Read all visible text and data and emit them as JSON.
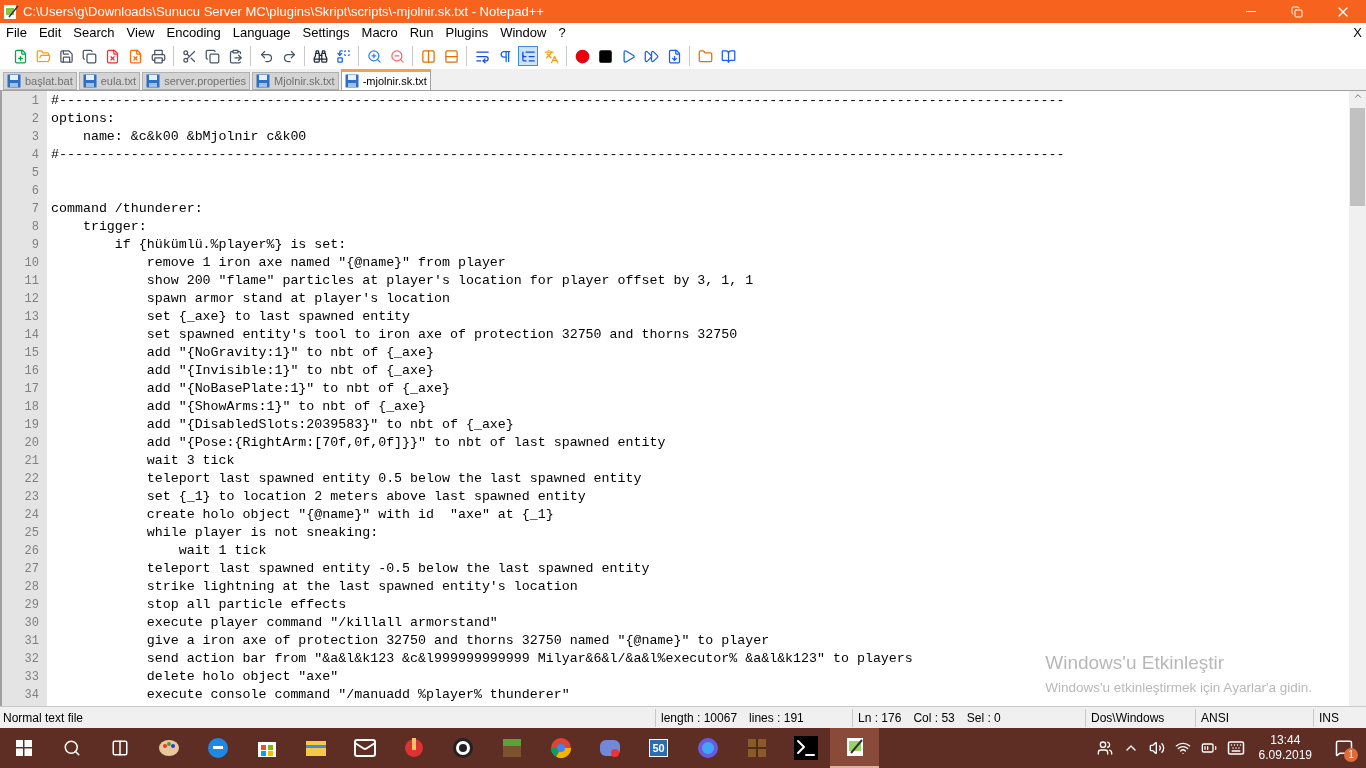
{
  "window": {
    "title": "C:\\Users\\g\\Downloads\\Sunucu Server MC\\plugins\\Skript\\scripts\\-mjolnir.sk.txt - Notepad++"
  },
  "menu": [
    "File",
    "Edit",
    "Search",
    "View",
    "Encoding",
    "Language",
    "Settings",
    "Macro",
    "Run",
    "Plugins",
    "Window",
    "?"
  ],
  "menu_close": "X",
  "toolbar": [
    {
      "kind": "new",
      "pressed": false
    },
    {
      "kind": "open",
      "pressed": false
    },
    {
      "kind": "save",
      "pressed": false
    },
    {
      "kind": "save-all",
      "pressed": false
    },
    {
      "kind": "close",
      "pressed": false
    },
    {
      "kind": "close-all",
      "pressed": false
    },
    {
      "kind": "print",
      "pressed": false
    },
    {
      "kind": "sep"
    },
    {
      "kind": "cut",
      "pressed": false
    },
    {
      "kind": "copy",
      "pressed": false
    },
    {
      "kind": "paste",
      "pressed": false
    },
    {
      "kind": "sep"
    },
    {
      "kind": "undo",
      "pressed": false
    },
    {
      "kind": "redo",
      "pressed": false
    },
    {
      "kind": "sep"
    },
    {
      "kind": "find",
      "pressed": false
    },
    {
      "kind": "replace",
      "pressed": false
    },
    {
      "kind": "sep"
    },
    {
      "kind": "zoom-in",
      "pressed": false
    },
    {
      "kind": "zoom-out",
      "pressed": false
    },
    {
      "kind": "sep"
    },
    {
      "kind": "sync-v",
      "pressed": false
    },
    {
      "kind": "sync-h",
      "pressed": false
    },
    {
      "kind": "sep"
    },
    {
      "kind": "wrap",
      "pressed": false
    },
    {
      "kind": "all-chars",
      "pressed": false
    },
    {
      "kind": "indent-guide",
      "pressed": true
    },
    {
      "kind": "lang",
      "pressed": false
    },
    {
      "kind": "sep"
    },
    {
      "kind": "record",
      "pressed": false
    },
    {
      "kind": "stop",
      "pressed": false
    },
    {
      "kind": "play",
      "pressed": false
    },
    {
      "kind": "play-multi",
      "pressed": false
    },
    {
      "kind": "save-macro",
      "pressed": false
    },
    {
      "kind": "sep"
    },
    {
      "kind": "folder",
      "pressed": false
    },
    {
      "kind": "spell",
      "pressed": false
    }
  ],
  "tabs": [
    {
      "label": "başlat.bat",
      "selected": false
    },
    {
      "label": "eula.txt",
      "selected": false
    },
    {
      "label": "server.properties",
      "selected": false
    },
    {
      "label": "Mjolnir.sk.txt",
      "selected": false
    },
    {
      "label": "-mjolnir.sk.txt",
      "selected": true
    }
  ],
  "editor": {
    "lines": [
      {
        "number": "1",
        "text": "#------------------------------------------------------------------------------------------------------------------------------"
      },
      {
        "number": "2",
        "text": "options:"
      },
      {
        "number": "3",
        "text": "    name: &c&k00 &bMjolnir c&k00"
      },
      {
        "number": "4",
        "text": "#------------------------------------------------------------------------------------------------------------------------------"
      },
      {
        "number": "5"
      },
      {
        "number": "6"
      },
      {
        "number": "7",
        "text": "command /thunderer:"
      },
      {
        "number": "8",
        "text": "    trigger:"
      },
      {
        "number": "9",
        "text": "        if {hükümlü.%player%} is set:"
      },
      {
        "number": "10",
        "text": "            remove 1 iron axe named \"{@name}\" from player"
      },
      {
        "number": "11",
        "text": "            show 200 \"flame\" particles at player's location for player offset by 3, 1, 1"
      },
      {
        "number": "12",
        "text": "            spawn armor stand at player's location"
      },
      {
        "number": "13",
        "text": "            set {_axe} to last spawned entity"
      },
      {
        "number": "14",
        "text": "            set spawned entity's tool to iron axe of protection 32750 and thorns 32750"
      },
      {
        "number": "15",
        "text": "            add \"{NoGravity:1}\" to nbt of {_axe}"
      },
      {
        "number": "16",
        "text": "            add \"{Invisible:1}\" to nbt of {_axe}"
      },
      {
        "number": "17",
        "text": "            add \"{NoBasePlate:1}\" to nbt of {_axe}"
      },
      {
        "number": "18",
        "text": "            add \"{ShowArms:1}\" to nbt of {_axe}"
      },
      {
        "number": "19",
        "text": "            add \"{DisabledSlots:2039583}\" to nbt of {_axe}"
      },
      {
        "number": "20",
        "text": "            add \"{Pose:{RightArm:[70f,0f,0f]}}\" to nbt of last spawned entity"
      },
      {
        "number": "21",
        "text": "            wait 3 tick"
      },
      {
        "number": "22",
        "text": "            teleport last spawned entity 0.5 below the last spawned entity"
      },
      {
        "number": "23",
        "text": "            set {_1} to location 2 meters above last spawned entity"
      },
      {
        "number": "24",
        "text": "            create holo object \"{@name}\" with id  \"axe\" at {_1}"
      },
      {
        "number": "25",
        "text": "            while player is not sneaking:"
      },
      {
        "number": "26",
        "text": "                wait 1 tick"
      },
      {
        "number": "27",
        "text": "            teleport last spawned entity -0.5 below the last spawned entity"
      },
      {
        "number": "28",
        "text": "            strike lightning at the last spawned entity's location"
      },
      {
        "number": "29",
        "text": "            stop all particle effects"
      },
      {
        "number": "30",
        "text": "            execute player command \"/killall armorstand\""
      },
      {
        "number": "31",
        "text": "            give a iron axe of protection 32750 and thorns 32750 named \"{@name}\" to player"
      },
      {
        "number": "32",
        "text": "            send action bar from \"&a&l&k123 &c&l999999999999 Milyar&6&l/&a&l%executor% &a&l&k123\" to players"
      },
      {
        "number": "33",
        "text": "            delete holo object \"axe\""
      },
      {
        "number": "34",
        "text": "            execute console command \"/manuadd %player% thunderer\""
      }
    ]
  },
  "activation": {
    "title": "Windows'u Etkinleştir",
    "message": "Windows'u etkinleştirmek için Ayarlar'a gidin."
  },
  "status_bar": {
    "file_type": "Normal text file",
    "length": "length : 10067",
    "lines": "lines : 191",
    "ln": "Ln : 176",
    "col": "Col : 53",
    "sel": "Sel : 0",
    "eol": "Dos\\Windows",
    "encoding": "ANSI",
    "mode": "INS"
  },
  "taskbar": {
    "apps": [
      {
        "kind": "paint",
        "active": false
      },
      {
        "kind": "edge",
        "active": false
      },
      {
        "kind": "store",
        "active": false
      },
      {
        "kind": "explorer",
        "active": false
      },
      {
        "kind": "mail",
        "active": false
      },
      {
        "kind": "ccleaner",
        "active": false
      },
      {
        "kind": "obs",
        "active": false
      },
      {
        "kind": "grass",
        "active": false
      },
      {
        "kind": "chrome",
        "active": false
      },
      {
        "kind": "discord",
        "active": false
      },
      {
        "kind": "fifty",
        "active": false
      },
      {
        "kind": "orb",
        "active": false
      },
      {
        "kind": "crate",
        "active": false
      },
      {
        "kind": "terminal",
        "active": false
      },
      {
        "kind": "notepad",
        "active": true
      }
    ],
    "fifty_label": "50",
    "time": "13:44",
    "date": "6.09.2019",
    "notifications": "1"
  }
}
